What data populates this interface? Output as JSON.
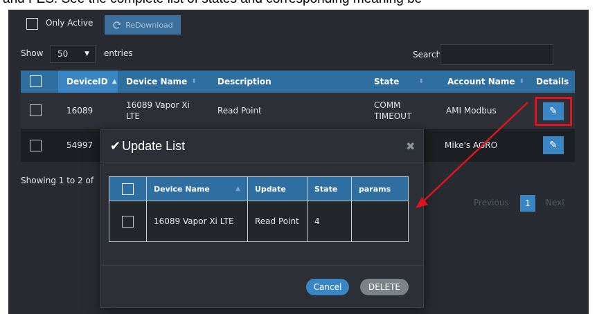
{
  "caption": "and FES. See the complete list of states and corresponding meaning be",
  "filters": {
    "only_active_label": "Only Active",
    "redownload_label": "ReDownload"
  },
  "length": {
    "show_label": "Show",
    "value": "50",
    "entries_label": "entries"
  },
  "search": {
    "label": "Search:",
    "value": ""
  },
  "table": {
    "headers": [
      "DeviceID",
      "Device Name",
      "Description",
      "State",
      "Account Name",
      "Details"
    ],
    "rows": [
      {
        "device_id": "16089",
        "device_name": "16089 Vapor Xi LTE",
        "description": "Read Point",
        "state": "COMM TIMEOUT",
        "account": "AMI Modbus"
      },
      {
        "device_id": "54997",
        "device_name": "",
        "description": "",
        "state": "",
        "account": "Mike's AGRO"
      }
    ],
    "info": "Showing 1 to 2 of"
  },
  "pagination": {
    "previous": "Previous",
    "current": "1",
    "next": "Next"
  },
  "modal": {
    "title": "Update List",
    "headers": [
      "Device Name",
      "Update",
      "State",
      "params"
    ],
    "rows": [
      {
        "device_name": "16089 Vapor Xi LTE",
        "update": "Read Point",
        "state": "4",
        "params": ""
      }
    ],
    "cancel_label": "Cancel",
    "delete_label": "DELETE"
  },
  "colors": {
    "accent": "#3a86c4",
    "annotation": "#e0141e",
    "bg": "#282c32"
  }
}
